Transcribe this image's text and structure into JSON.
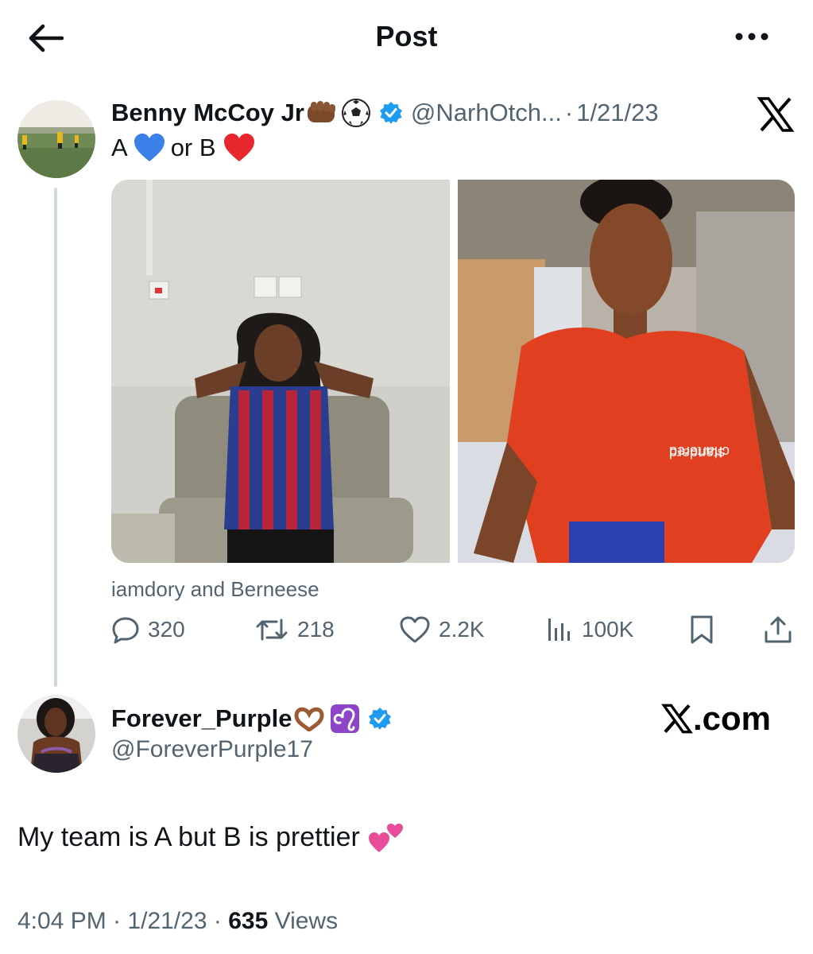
{
  "header": {
    "title": "Post",
    "back_icon": "back-arrow-icon",
    "more_icon": "more-horizontal-icon"
  },
  "quoted_post": {
    "author_name": "Benny McCoy Jr",
    "name_emojis": [
      "fist-icon",
      "soccer-ball-icon"
    ],
    "handle": "@NarhOtch...",
    "separator": "·",
    "date": "1/21/23",
    "text_a": "A",
    "text_or_b": "or B",
    "text_emojis": [
      "blue-heart-icon",
      "red-heart-icon"
    ],
    "tagged": "iamdory and Berneese",
    "stats": {
      "replies": "320",
      "reposts": "218",
      "likes": "2.2K",
      "views": "100K"
    }
  },
  "reply": {
    "author_name": "Forever_Purple",
    "name_emojis": [
      "heart-hands-icon",
      "leo-sign-icon"
    ],
    "handle": "@ForeverPurple17",
    "text": "My team is A but B is prettier",
    "text_emoji": "two-hearts-icon",
    "time": "4:04 PM",
    "sep1": "·",
    "date": "1/21/23",
    "sep2": "·",
    "views_count": "635",
    "views_label": "Views"
  },
  "watermark": {
    "text": ".com"
  },
  "colors": {
    "text": "#0f1419",
    "muted": "#536471",
    "verified": "#1d9bf0",
    "thread_line": "#cfd9de"
  }
}
